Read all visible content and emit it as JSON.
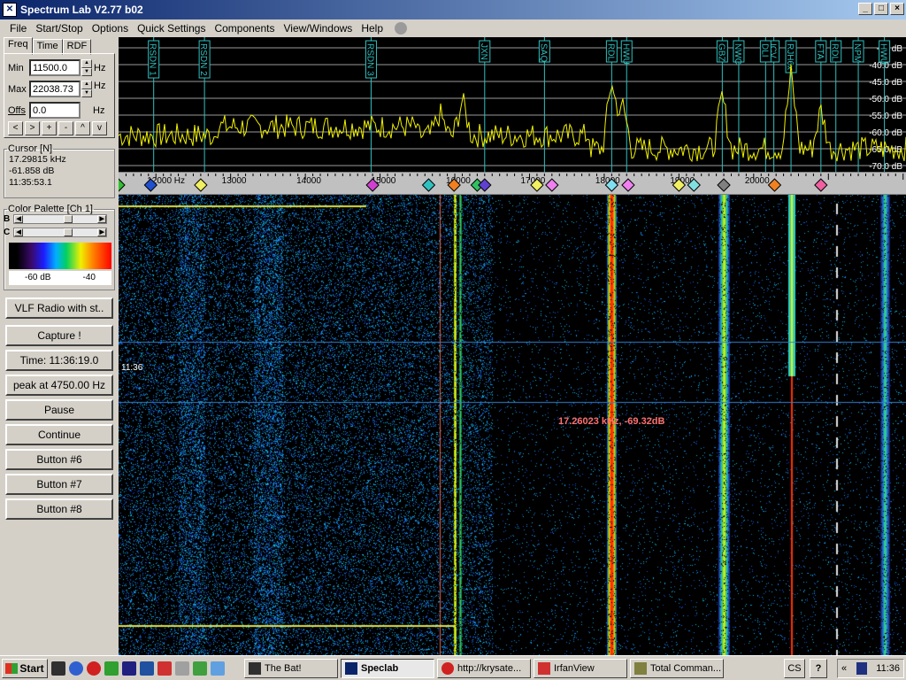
{
  "window": {
    "title": "Spectrum Lab V2.77 b02",
    "app_icon": "spectrum-lab-icon"
  },
  "menu": [
    "File",
    "Start/Stop",
    "Options",
    "Quick Settings",
    "Components",
    "View/Windows",
    "Help"
  ],
  "tabs": [
    "Freq",
    "Time",
    "RDF"
  ],
  "freq": {
    "min_label": "Min",
    "min_value": "11500.0",
    "max_label": "Max",
    "max_value": "22038.73",
    "offs_label": "Offs",
    "offs_value": "0.0",
    "unit": "Hz"
  },
  "nav_buttons": [
    "<",
    ">",
    "+",
    "-",
    "^",
    "v"
  ],
  "cursor_box": {
    "title": "Cursor [N]",
    "line1": "17.29815 kHz",
    "line2": "-61.858 dB",
    "line3": "11:35:53.1"
  },
  "palette": {
    "title": "Color Palette [Ch 1]",
    "b_label": "B",
    "c_label": "C",
    "b_level": 0.55,
    "c_level": 0.55,
    "low": "-60 dB",
    "high": "-40"
  },
  "buttons": [
    "VLF Radio with st..",
    "Capture !",
    "Time:  11:36:19.0",
    "peak at 4750.00 Hz",
    "Pause",
    "Continue",
    "Button #6",
    "Button #7",
    "Button #8"
  ],
  "spectrum": {
    "db_labels": [
      "-35 dB",
      "-40.0 dB",
      "-45.0 dB",
      "-50.0 dB",
      "-55.0 dB",
      "-60.0 dB",
      "-65.0 dB",
      "-70.0 dB"
    ],
    "markers": [
      {
        "label": "RSDN 1",
        "freq": 11970
      },
      {
        "label": "RSDN 2",
        "freq": 12650
      },
      {
        "label": "RSDN 3",
        "freq": 14880
      },
      {
        "label": "JXN",
        "freq": 16400
      },
      {
        "label": "SAQ",
        "freq": 17200
      },
      {
        "label": "RDL",
        "freq": 18100
      },
      {
        "label": "HWU",
        "freq": 18300
      },
      {
        "label": "GBZ",
        "freq": 19580
      },
      {
        "label": "NWC",
        "freq": 19800
      },
      {
        "label": "ICV",
        "freq": 20270
      },
      {
        "label": "DLI",
        "freq": 20160
      },
      {
        "label": "RJH6x",
        "freq": 20500
      },
      {
        "label": "FTA",
        "freq": 20900
      },
      {
        "label": "RDL",
        "freq": 21100
      },
      {
        "label": "NPM",
        "freq": 21400
      },
      {
        "label": "HWU",
        "freq": 21750
      }
    ]
  },
  "scale": {
    "labels": [
      "12000 Hz",
      "13000",
      "14000",
      "15000",
      "16000",
      "17000",
      "18000",
      "19000",
      "20000"
    ],
    "min_hz": 11500,
    "max_hz": 22038.73
  },
  "waterfall": {
    "time_label": "11:36",
    "cursor_readout": "17.26023 kHz, -69.32dB"
  },
  "taskbar": {
    "start": "Start",
    "tasks": [
      "The Bat!",
      "Speclab",
      "http://krysate...",
      "IrfanView",
      "Total Comman..."
    ],
    "active_task": "Speclab",
    "lang": "CS",
    "help": "?",
    "clock": "11:36"
  }
}
